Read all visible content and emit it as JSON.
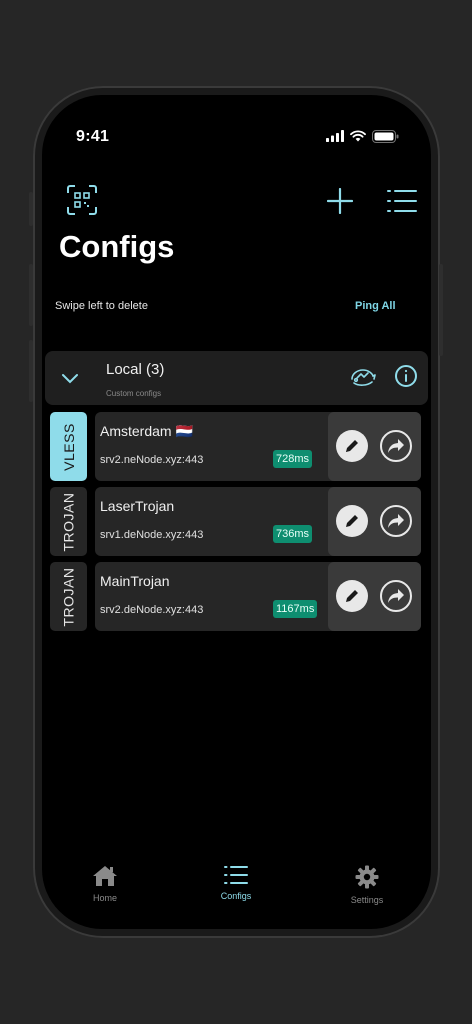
{
  "status": {
    "time": "9:41"
  },
  "header": {
    "title": "Configs",
    "swipe_hint": "Swipe left to delete",
    "ping_all": "Ping All"
  },
  "icons": {
    "qr": "qr-code-icon",
    "add": "plus-icon",
    "list": "list-icon",
    "chevron": "chevron-down-icon",
    "speed": "speed-icon",
    "info": "info-icon",
    "edit": "pencil-icon",
    "share": "share-icon"
  },
  "group": {
    "title": "Local (3)",
    "subtitle": "Custom configs"
  },
  "configs": [
    {
      "protocol": "VLESS",
      "name": "Amsterdam 🇳🇱",
      "host": "srv2.neNode.xyz:443",
      "ping": "728ms",
      "active": true
    },
    {
      "protocol": "TROJAN",
      "name": "LaserTrojan",
      "host": "srv1.deNode.xyz:443",
      "ping": "736ms",
      "active": false
    },
    {
      "protocol": "TROJAN",
      "name": "MainTrojan",
      "host": "srv2.deNode.xyz:443",
      "ping": "1167ms",
      "active": false
    }
  ],
  "tabbar": {
    "home": "Home",
    "configs": "Configs",
    "settings": "Settings"
  },
  "colors": {
    "accent": "#8fdcea",
    "ping_bg": "#0e8e70",
    "background": "#000000",
    "card": "#262626"
  }
}
